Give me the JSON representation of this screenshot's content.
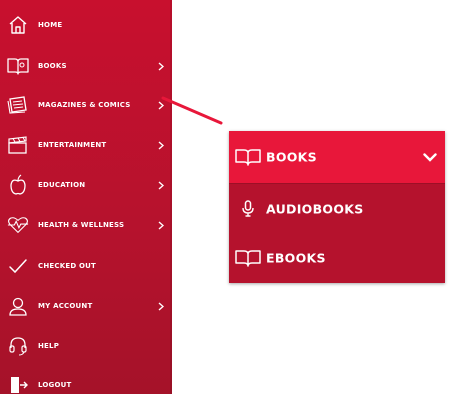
{
  "colors": {
    "sidebar_bg": "#c8102e",
    "panel_bg": "#b5122d",
    "panel_header_bg": "#e8173a",
    "connector": "#e8173a",
    "text": "#ffffff"
  },
  "sidebar": {
    "items": [
      {
        "label": "HOME",
        "icon": "home-icon",
        "has_chevron": false
      },
      {
        "label": "BOOKS",
        "icon": "book-icon",
        "has_chevron": true
      },
      {
        "label": "MAGAZINES & COMICS",
        "icon": "magazine-icon",
        "has_chevron": true
      },
      {
        "label": "ENTERTAINMENT",
        "icon": "clapperboard-icon",
        "has_chevron": true
      },
      {
        "label": "EDUCATION",
        "icon": "apple-icon",
        "has_chevron": true
      },
      {
        "label": "HEALTH & WELLNESS",
        "icon": "heartbeat-icon",
        "has_chevron": true
      },
      {
        "label": "CHECKED OUT",
        "icon": "checkmark-icon",
        "has_chevron": false
      },
      {
        "label": "MY ACCOUNT",
        "icon": "user-icon",
        "has_chevron": true
      },
      {
        "label": "HELP",
        "icon": "headset-icon",
        "has_chevron": false
      },
      {
        "label": "LOGOUT",
        "icon": "logout-icon",
        "has_chevron": false
      }
    ]
  },
  "dropdown": {
    "header": {
      "label": "BOOKS",
      "icon": "open-book-icon",
      "expanded": true
    },
    "items": [
      {
        "label": "AUDIOBOOKS",
        "icon": "microphone-icon"
      },
      {
        "label": "EBOOKS",
        "icon": "open-book-icon"
      }
    ]
  }
}
